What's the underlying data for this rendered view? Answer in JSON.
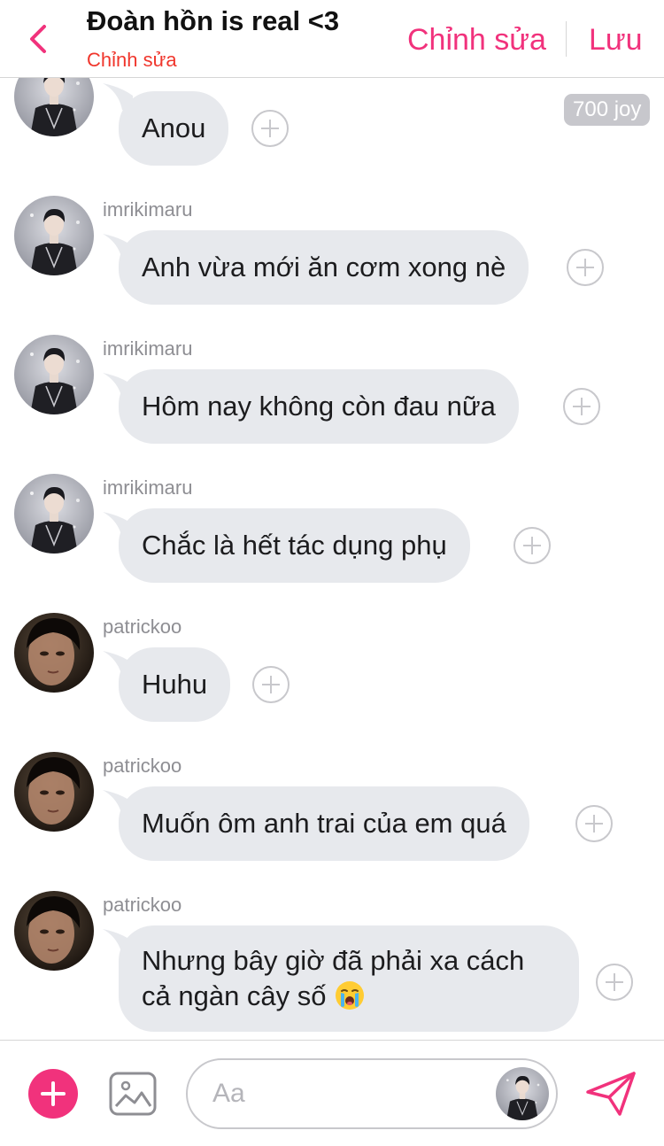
{
  "header": {
    "title": "Đoàn hồn is real <3",
    "subtitle": "Chỉnh sửa",
    "edit_label": "Chỉnh sửa",
    "save_label": "Lưu",
    "accent_color": "#f1327c"
  },
  "messages": [
    {
      "username": "",
      "text": "Anou",
      "avatar": "imrikimaru-avatar"
    },
    {
      "username": "imrikimaru",
      "text": "Anh vừa mới ăn cơm xong nè",
      "avatar": "imrikimaru-avatar"
    },
    {
      "username": "imrikimaru",
      "text": "Hôm nay không còn đau nữa",
      "avatar": "imrikimaru-avatar"
    },
    {
      "username": "imrikimaru",
      "text": "Chắc là hết tác dụng phụ",
      "avatar": "imrikimaru-avatar"
    },
    {
      "username": "patrickoo",
      "text": "Huhu",
      "avatar": "patrickoo-avatar"
    },
    {
      "username": "patrickoo",
      "text": "Muốn ôm anh trai của em quá",
      "avatar": "patrickoo-avatar"
    },
    {
      "username": "patrickoo",
      "text_line1": "Nhưng bây giờ đã phải xa cách",
      "text_line2": "cả ngàn cây số",
      "emoji": "loudly-crying-face-icon",
      "avatar": "patrickoo-avatar"
    }
  ],
  "joy_badge": "700 joy",
  "composer": {
    "placeholder": "Aa"
  }
}
